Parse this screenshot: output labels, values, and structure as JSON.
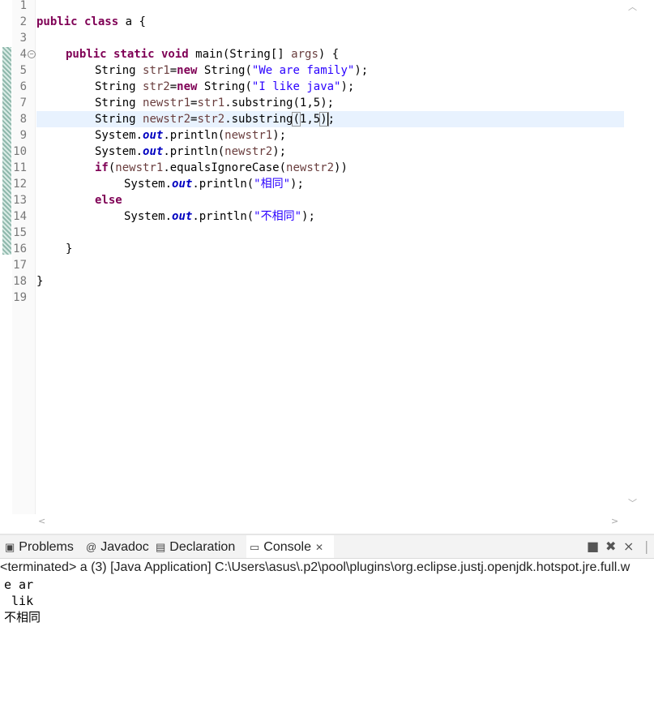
{
  "editor": {
    "line_numbers": [
      "1",
      "2",
      "3",
      "4",
      "5",
      "6",
      "7",
      "8",
      "9",
      "10",
      "11",
      "12",
      "13",
      "14",
      "15",
      "16",
      "17",
      "18",
      "19"
    ],
    "code": {
      "l2_kw": "public class",
      "l2_rest": " a {",
      "l4_kw": "public static void",
      "l4_a": " main(String[] ",
      "l4_var": "args",
      "l4_b": ") {",
      "l5_a": "String ",
      "l5_var": "str1",
      "l5_b": "=",
      "l5_kw": "new",
      "l5_c": " String(",
      "l5_str": "\"We are family\"",
      "l5_d": ");",
      "l6_a": "String ",
      "l6_var": "str2",
      "l6_b": "=",
      "l6_kw": "new",
      "l6_c": " String(",
      "l6_str": "\"I like java\"",
      "l6_d": ");",
      "l7_a": "String ",
      "l7_var": "newstr1",
      "l7_b": "=",
      "l7_var2": "str1",
      "l7_c": ".substring(1,5);",
      "l8_a": "String ",
      "l8_var": "newstr2",
      "l8_b": "=",
      "l8_var2": "str2",
      "l8_c": ".substring",
      "l8_p1": "(",
      "l8_d": "1,5",
      "l8_p2": ")",
      "l8_e": ";",
      "l9_a": "System.",
      "l9_fld": "out",
      "l9_b": ".println(",
      "l9_var": "newstr1",
      "l9_c": ");",
      "l10_a": "System.",
      "l10_fld": "out",
      "l10_b": ".println(",
      "l10_var": "newstr2",
      "l10_c": ");",
      "l11_kw": "if",
      "l11_a": "(",
      "l11_var": "newstr1",
      "l11_b": ".equalsIgnoreCase(",
      "l11_var2": "newstr2",
      "l11_c": "))",
      "l12_a": "System.",
      "l12_fld": "out",
      "l12_b": ".println(",
      "l12_str": "\"相同\"",
      "l12_c": ");",
      "l13_kw": "else",
      "l14_a": "System.",
      "l14_fld": "out",
      "l14_b": ".println(",
      "l14_str": "\"不相同\"",
      "l14_c": ");",
      "l16": "}",
      "l18": "}"
    },
    "icons": {
      "fold": "collapse-minus-icon",
      "scroll_up": "chevron-up-icon",
      "scroll_down": "chevron-down-icon",
      "scroll_left": "chevron-left-icon",
      "scroll_right": "chevron-right-icon"
    }
  },
  "panel": {
    "tabs": [
      {
        "label": "Problems",
        "icon": "problems-icon"
      },
      {
        "label": "Javadoc",
        "icon": "at-sign-icon"
      },
      {
        "label": "Declaration",
        "icon": "declaration-icon"
      },
      {
        "label": "Console",
        "icon": "console-icon",
        "active": true
      }
    ],
    "toolbar": [
      "terminate-icon",
      "remove-launch-icon",
      "remove-all-terminated-icon"
    ],
    "terminated_text": "<terminated> a (3) [Java Application] C:\\Users\\asus\\.p2\\pool\\plugins\\org.eclipse.justj.openjdk.hotspot.jre.full.w",
    "console_output": [
      "e ar",
      " lik",
      "不相同"
    ]
  },
  "colors": {
    "keyword": "#7f0055",
    "string": "#2a00ff",
    "variable": "#6a3e3e",
    "field": "#0000c0",
    "current_line": "#e8f2fe"
  }
}
